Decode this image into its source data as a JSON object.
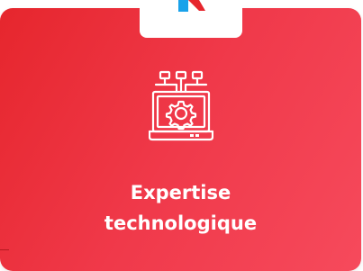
{
  "brand": {
    "logo_icon": "k-logo-icon",
    "logo_colors": {
      "blue": "#19a2ea",
      "red": "#e6262d"
    }
  },
  "card": {
    "icon": "laptop-gear-network-icon",
    "title_line1": "Expertise",
    "title_line2": "technologique",
    "gradient_start": "#e6262d",
    "gradient_end": "#f64a5c",
    "text_color": "#ffffff"
  }
}
